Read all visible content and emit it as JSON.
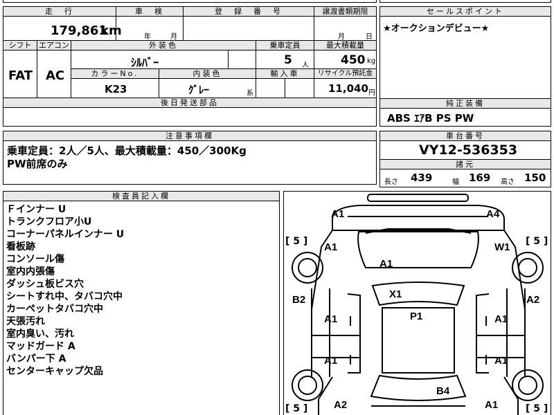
{
  "header": {
    "mileage_label": "走　行",
    "mileage_value": "179,861",
    "mileage_unit": "km",
    "inspection_label": "車　検",
    "inspection_year": "年",
    "inspection_month": "月",
    "registration_label": "登　録　番　号",
    "transfer_label": "譲渡書類期限",
    "transfer_month": "月",
    "transfer_day": "日",
    "sales_point_label": "セールスポイント",
    "sales_point_text": "★オークションデビュー★"
  },
  "spec": {
    "shift_label": "シフト",
    "shift_value": "FAT",
    "ac_label": "エアコン",
    "ac_value": "AC",
    "exterior_label": "外装色",
    "exterior_value": "ｼﾙﾊﾞｰ",
    "capacity_label": "乗車定員",
    "capacity_value": "5",
    "capacity_unit": "人",
    "maxload_label": "最大積載量",
    "maxload_value": "450",
    "maxload_unit": "kg",
    "color_no_label": "カラーNo.",
    "color_no_value": "K23",
    "interior_label": "内装色",
    "interior_value": "ｸﾞﾚｰ",
    "interior_suffix": "系",
    "import_label": "輸入車",
    "recycle_label": "リサイクル預託金",
    "recycle_value": "11,040",
    "recycle_unit": "円",
    "delivery_label": "後日発送部品"
  },
  "equipment": {
    "label": "純正装備",
    "value": "ABS ｴｱB PS PW"
  },
  "caution": {
    "label": "注意事項欄",
    "lines": [
      "乗車定員：2人／5人、最大積載量：450／300Kg",
      "PW前席のみ"
    ]
  },
  "chassis": {
    "label": "車台番号",
    "value": "VY12-536353",
    "dims_label": "諸元",
    "length_label": "長さ",
    "length_value": "439",
    "width_label": "幅",
    "width_value": "169",
    "height_label": "高さ",
    "height_value": "150"
  },
  "inspector": {
    "label": "検査員記入欄",
    "lines": [
      "Ｆインナー U",
      "トランクフロア小U",
      "コーナーパネルインナー U",
      "看板跡",
      "コンソール傷",
      "室内内張傷",
      "ダッシュ板ビス穴",
      "シートすれ中、タバコ穴中",
      "カーペットタバコ穴中",
      "天張汚れ",
      "室内臭い、汚れ",
      "マッドガード A",
      "バンパー下 A",
      "センターキャップ欠品"
    ]
  },
  "diagram": {
    "marks": {
      "top_left": "A1",
      "top_right": "A4",
      "fender_left": "A1",
      "fender_right": "W1",
      "hood": "A1",
      "door_left": "B2",
      "door_right": "A2",
      "windshield": "X1",
      "roof": "P1",
      "front_door_left": "A1",
      "front_door_right": "A1",
      "rear_door_left": "A1",
      "rear_door_right": "A1",
      "trunk": "B4",
      "rear_left": "A2",
      "rear_right": "A1"
    },
    "tire_left_top": "[ 5 ]",
    "tire_right_top": "[ 5 ]",
    "tire_left_bottom": "[ 5 ]",
    "tire_right_bottom": "[ 5 ]"
  }
}
